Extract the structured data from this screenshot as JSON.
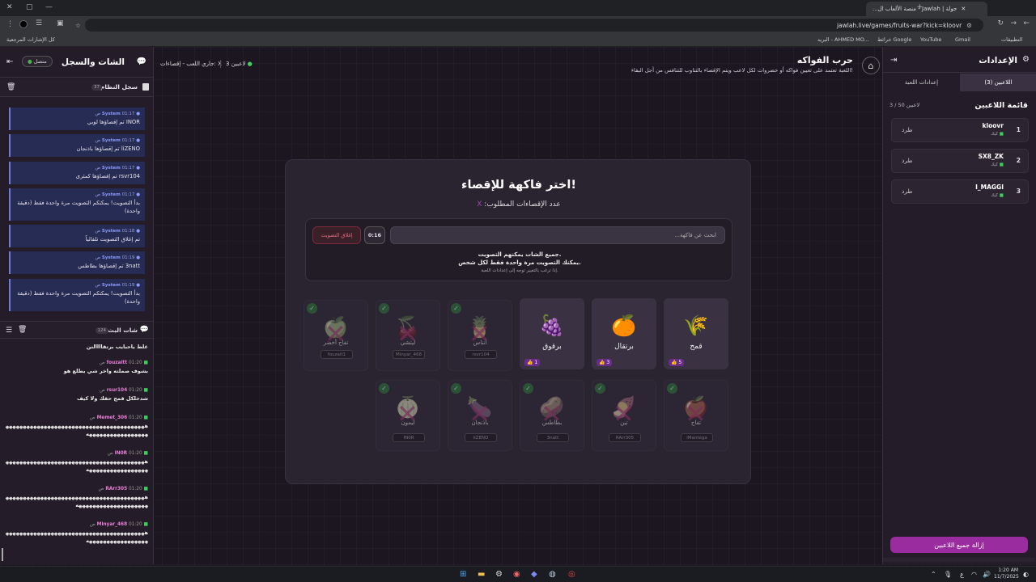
{
  "browser": {
    "tab_title": "جولة | Jawlah - منصة الألعاب ال...",
    "url": "jawlah.live/games/fruits-war?kick=kloovr",
    "bookmarks": [
      "Gmail",
      "YouTube",
      "خرائط Google",
      "البريد - AHMED MO...",
      "التطبيقات"
    ],
    "all_bookmarks": "كل الإشارات المرجعية"
  },
  "header": {
    "title": "حرب الفواكه",
    "description": "اللعبة تعتمد على تعيين فواكه أو خضروات لكل لاعب ويتم الإقصاء بالتناوب للتنافس من أجل البقاء!",
    "players_count": "3 لاعبين",
    "status": "جاري اللعب - إقصاءات: X"
  },
  "chat": {
    "title": "الشات والسجل",
    "connected": "متصل",
    "system_log_title": "سجل النظام",
    "system_log_count": "37",
    "system_messages": [
      {
        "sender": "System",
        "time": "01:17 ص",
        "text": "INOR تم إقصاؤها لوبي"
      },
      {
        "sender": "System",
        "time": "01:17 ص",
        "text": "liZENO تم إقصاؤها باذنجان"
      },
      {
        "sender": "System",
        "time": "01:17 ص",
        "text": "rsvr104 تم إقصاؤها كمثرى"
      },
      {
        "sender": "System",
        "time": "01:17 ص",
        "text": "بدأ التصويت! يمكنكم التصويت مرة واحدة فقط (دقيقة واحدة)"
      },
      {
        "sender": "System",
        "time": "01:18 ص",
        "text": "تم إغلاق التصويت تلقائياً"
      },
      {
        "sender": "System",
        "time": "01:19 ص",
        "text": "3natt تم إقصاؤها بطاطس"
      },
      {
        "sender": "System",
        "time": "01:19 ص",
        "text": "بدأ التصويت! يمكنكم التصويت مرة واحدة فقط (دقيقة واحدة)"
      }
    ],
    "live_chat_title": "شات البث",
    "live_chat_count": "124",
    "live_messages": [
      {
        "user": "",
        "time": "",
        "text": "غلط ياحبايب برتقاااالنن"
      },
      {
        "user": "fouzaitt",
        "time": "01:20 ص",
        "text": "بشوف صملته واخر شي يطلع هو"
      },
      {
        "user": "rsur104",
        "time": "01:20 ص",
        "text": "شدخلكل قمح حقك ولا كيف"
      },
      {
        "user": "Memet_306",
        "time": "01:20 ص",
        "text": "ههههههههههههههههههههههههههههههههههههههههههههههههههههههههههه"
      },
      {
        "user": "IN0R",
        "time": "01:20 ص",
        "text": "ههههههههههههههههههههههههههههههههههههههههههههههههههههههههههه"
      },
      {
        "user": "RArr305",
        "time": "01:20 ص",
        "text": "هههههههههههههههههههههههههههههههههههههههههههههههههههههههههههههه"
      },
      {
        "user": "Minyar_468",
        "time": "01:20 ص",
        "text": "ههههههههههههههههههههههههههههههههههههههههههههههههههههههههههه"
      }
    ]
  },
  "game": {
    "title": "اختر فاكهة للإقصاء!",
    "required_label": "عدد الإقصاءات المطلوب:",
    "required_value": "X",
    "search_placeholder": "ابحث عن فاكهة...",
    "timer": "0:16",
    "close_vote": "إغلاق التصويت",
    "note1": "جميع الشات يمكنهم التصويت.",
    "note2": "يمكنك التصويت مرة واحدة فقط لكل شخص.",
    "note3": "إذا ترغب بالتغيير توجه إلى إعدادات اللعبة.",
    "alive": [
      {
        "name": "قمح",
        "emoji": "🌾",
        "votes": "5"
      },
      {
        "name": "برتقال",
        "emoji": "🍊",
        "votes": "3"
      },
      {
        "name": "برقوق",
        "emoji": "🍇",
        "votes": "1"
      }
    ],
    "eliminated_row1": [
      {
        "name": "أنناس",
        "emoji": "🍍",
        "player": "rsvr104"
      },
      {
        "name": "ليتشي",
        "emoji": "🍒",
        "player": "Minyar_468"
      },
      {
        "name": "تفاح أخضر",
        "emoji": "🍏",
        "player": "fouzait1"
      }
    ],
    "eliminated_row2": [
      {
        "name": "تفاح",
        "emoji": "🍎",
        "player": "iMantega"
      },
      {
        "name": "تين",
        "emoji": "🍠",
        "player": "RArr305"
      },
      {
        "name": "بطاطس",
        "emoji": "🥔",
        "player": "3natt"
      },
      {
        "name": "باذنجان",
        "emoji": "🍆",
        "player": "liZENO"
      },
      {
        "name": "ليمون",
        "emoji": "🍈",
        "player": "IN0R"
      }
    ]
  },
  "settings": {
    "title": "الإعدادات",
    "tab_players": "اللاعبين (3)",
    "tab_game": "إعدادات اللعبة",
    "list_title": "قائمة اللاعبين",
    "list_count": "3 / 50 لاعبين",
    "kick": "طرد",
    "players": [
      {
        "num": "1",
        "name": "kloovr",
        "platform": "كيك"
      },
      {
        "num": "2",
        "name": "SX8_ZK",
        "platform": "كيك"
      },
      {
        "num": "3",
        "name": "I_MAGGI",
        "platform": "كيك"
      }
    ],
    "remove_all": "إزالة جميع اللاعبين"
  },
  "taskbar": {
    "time": "1:20 AM",
    "date": "11/7/2025",
    "lang": "ع"
  }
}
